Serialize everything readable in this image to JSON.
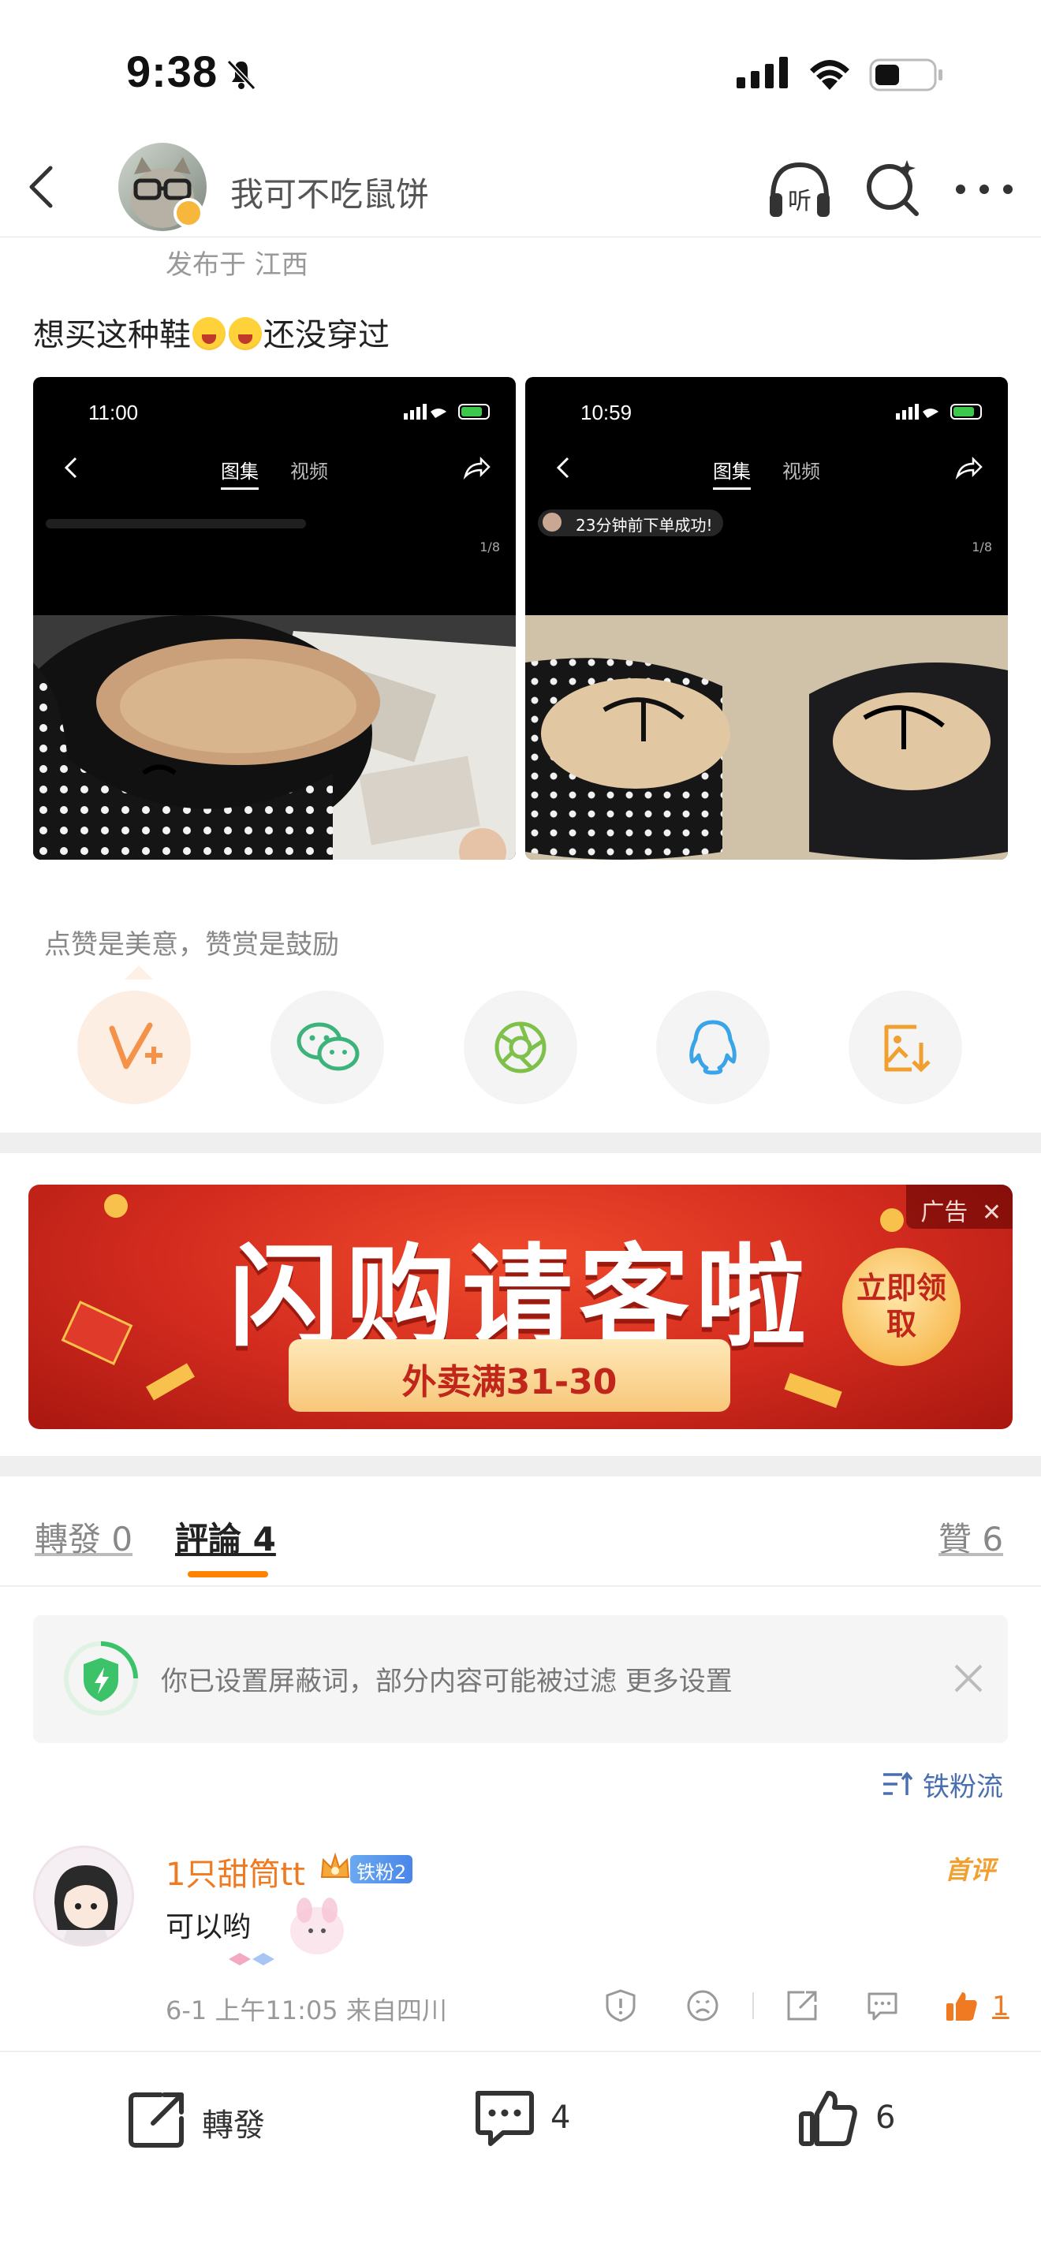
{
  "status_bar": {
    "time": "9:38"
  },
  "header": {
    "username": "我可不吃鼠饼"
  },
  "post": {
    "location": "发布于 江西",
    "text_before": "想买这种鞋",
    "text_after": "还没穿过",
    "images": [
      {
        "time": "11:00",
        "tab_active": "图集",
        "tab_inactive": "视频",
        "counter": "1/8",
        "pill_text": ""
      },
      {
        "time": "10:59",
        "tab_active": "图集",
        "tab_inactive": "视频",
        "counter": "1/8",
        "pill_text": "23分钟前下单成功!"
      }
    ]
  },
  "reward": {
    "hint": "点赞是美意，赞赏是鼓励",
    "share_targets": [
      "v-plus-icon",
      "wechat-icon",
      "moments-icon",
      "qq-icon",
      "save-image-icon"
    ]
  },
  "ad": {
    "title": "闪购请客啦",
    "subtitle": "外卖满31-30",
    "button": "立即领取",
    "tag": "广告",
    "colors": {
      "background": "#d12a1e",
      "ribbon": "#f7c77a",
      "button": "#f7b74c"
    }
  },
  "tabs": {
    "repost": "轉發 0",
    "comments": "評論 4",
    "likes": "贊 6",
    "accent": "#ff8200"
  },
  "notice": {
    "text": "你已设置屏蔽词，部分内容可能被过滤 更多设置"
  },
  "sort": {
    "label": "铁粉流"
  },
  "comments": [
    {
      "user": "1只甜筒tt",
      "badge": "铁粉2",
      "first_tag": "首评",
      "text": "可以哟",
      "meta": "6-1 上午11:05  来自四川",
      "likes": "1"
    }
  ],
  "bottom_bar": {
    "repost": "轉發",
    "comments": "4",
    "likes": "6"
  }
}
